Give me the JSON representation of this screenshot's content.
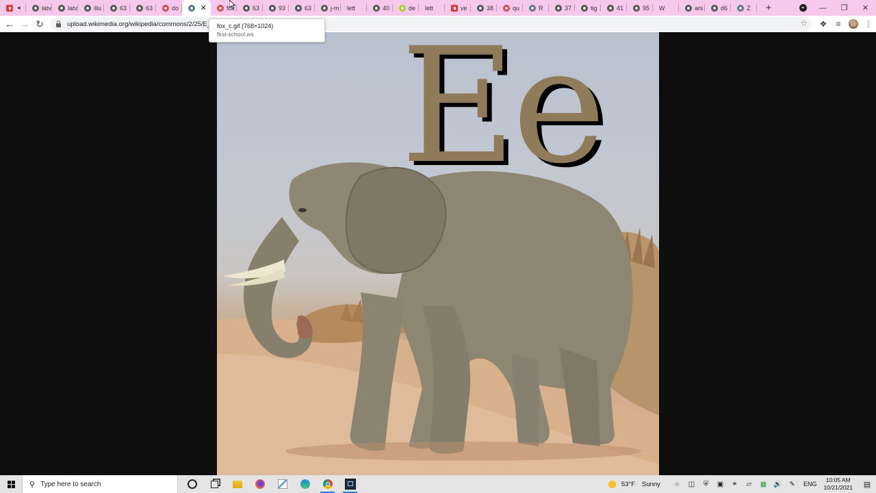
{
  "browser": {
    "tabs": [
      {
        "label": "",
        "icon": "youtube-icon",
        "fav": "red",
        "audio": true
      },
      {
        "label": "latv",
        "icon": "globe-icon",
        "fav": "globe"
      },
      {
        "label": "latv",
        "icon": "globe-icon",
        "fav": "globe"
      },
      {
        "label": "illu",
        "icon": "globe-icon",
        "fav": "globe"
      },
      {
        "label": "63",
        "icon": "globe-icon",
        "fav": "globe"
      },
      {
        "label": "63",
        "icon": "globe-icon",
        "fav": "globe"
      },
      {
        "label": "do",
        "icon": "ladybug-icon",
        "fav": "bug"
      },
      {
        "label": "",
        "icon": "wikimedia-icon",
        "fav": "ww",
        "active": true
      },
      {
        "label": "fox",
        "icon": "ladybug-icon",
        "fav": "bug"
      },
      {
        "label": "63",
        "icon": "globe-icon",
        "fav": "globe"
      },
      {
        "label": "93",
        "icon": "globe-icon",
        "fav": "globe"
      },
      {
        "label": "63",
        "icon": "globe-icon",
        "fav": "globe"
      },
      {
        "label": "j-m",
        "icon": "globe-icon",
        "fav": "globe"
      },
      {
        "label": "lett",
        "icon": "",
        "fav": "none"
      },
      {
        "label": "40",
        "icon": "globe-icon",
        "fav": "globe"
      },
      {
        "label": "de",
        "icon": "green-circle-icon",
        "fav": "green"
      },
      {
        "label": "lett",
        "icon": "",
        "fav": "none"
      },
      {
        "label": "ve",
        "icon": "red-check-icon",
        "fav": "red"
      },
      {
        "label": "38",
        "icon": "globe-icon",
        "fav": "globe"
      },
      {
        "label": "qu",
        "icon": "ladybug-icon",
        "fav": "bug"
      },
      {
        "label": "R",
        "icon": "wikimedia-icon",
        "fav": "ww"
      },
      {
        "label": "37",
        "icon": "globe-icon",
        "fav": "globe"
      },
      {
        "label": "tig",
        "icon": "globe-icon",
        "fav": "globe"
      },
      {
        "label": "41",
        "icon": "globe-icon",
        "fav": "globe"
      },
      {
        "label": "95",
        "icon": "globe-icon",
        "fav": "globe"
      },
      {
        "label": "W",
        "icon": "",
        "fav": "none"
      },
      {
        "label": "ani",
        "icon": "globe-icon",
        "fav": "globe"
      },
      {
        "label": "d6",
        "icon": "globe-icon",
        "fav": "globe"
      },
      {
        "label": "Z",
        "icon": "wikimedia-icon",
        "fav": "ww"
      }
    ],
    "new_tab_label": "+",
    "url": "upload.wikimedia.org/wikipedia/commons/2/25/E_",
    "tooltip": {
      "title": "fox_c.gif (768×1024)",
      "subtitle": "first-school.ws"
    }
  },
  "image": {
    "letters": "Ee",
    "letter_color": "#8f7b5a"
  },
  "taskbar": {
    "search_placeholder": "Type here to search",
    "weather_temp": "53°F",
    "weather_condition": "Sunny",
    "language": "ENG",
    "time": "10:05 AM",
    "date": "10/21/2021"
  },
  "colors": {
    "tabstrip": "#f6c9ec",
    "taskbar": "#e4e4e4",
    "accent": "#2b7bd6"
  }
}
